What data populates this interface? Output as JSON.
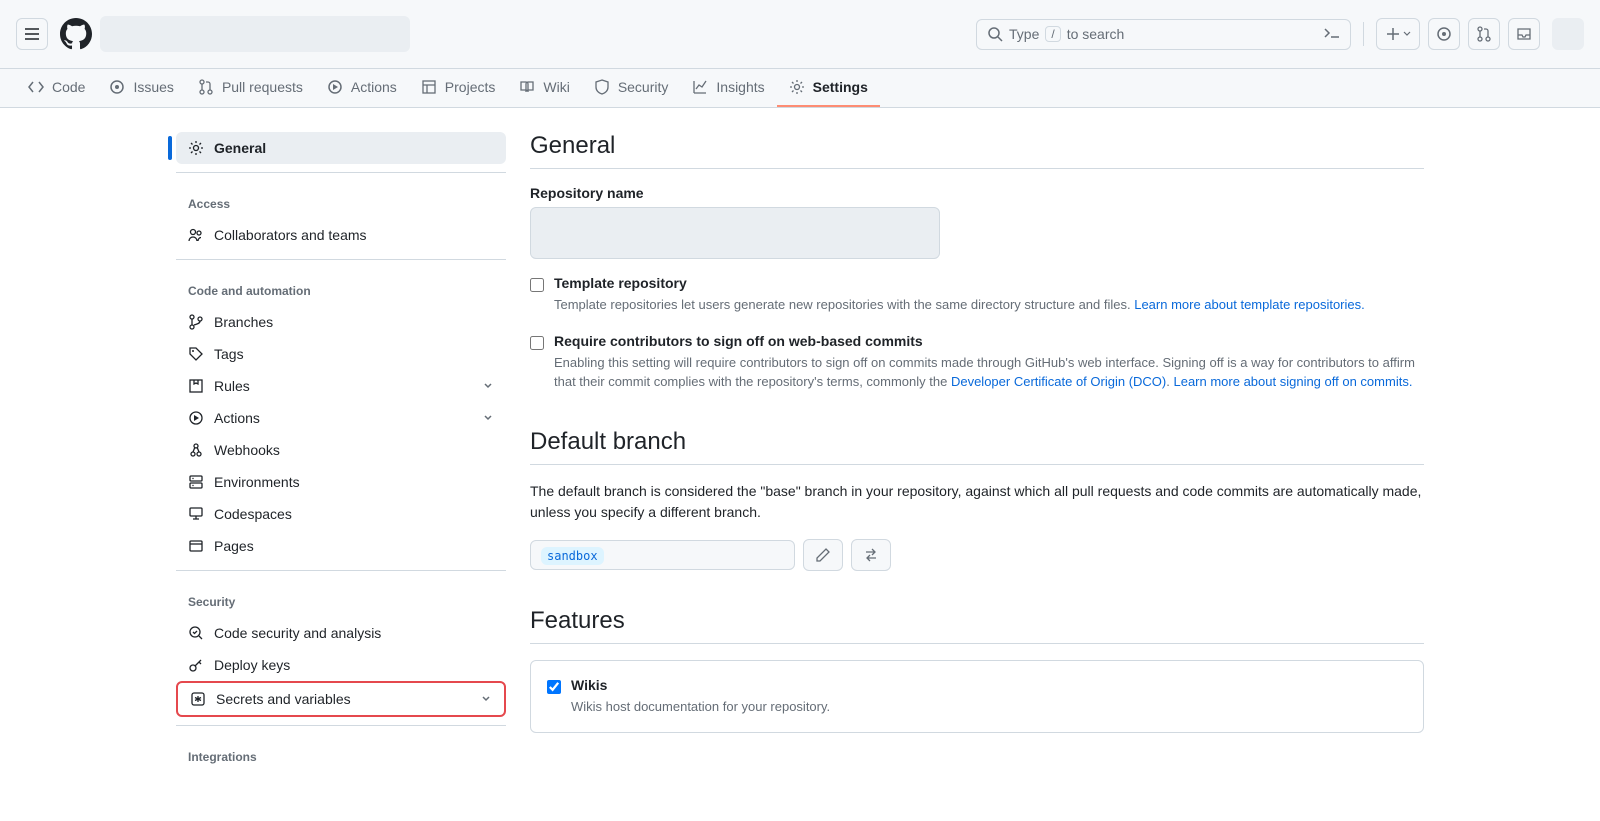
{
  "search": {
    "before": "Type",
    "kbd": "/",
    "after": "to search"
  },
  "repo_nav": {
    "code": "Code",
    "issues": "Issues",
    "pulls": "Pull requests",
    "actions": "Actions",
    "projects": "Projects",
    "wiki": "Wiki",
    "security": "Security",
    "insights": "Insights",
    "settings": "Settings"
  },
  "sidebar": {
    "general": "General",
    "access_hd": "Access",
    "collab": "Collaborators and teams",
    "code_hd": "Code and automation",
    "branches": "Branches",
    "tags": "Tags",
    "rules": "Rules",
    "actions": "Actions",
    "webhooks": "Webhooks",
    "environments": "Environments",
    "codespaces": "Codespaces",
    "pages": "Pages",
    "security_hd": "Security",
    "codesec": "Code security and analysis",
    "deploy": "Deploy keys",
    "secrets": "Secrets and variables",
    "integrations_hd": "Integrations"
  },
  "general": {
    "heading": "General",
    "repo_name_label": "Repository name",
    "template": {
      "title": "Template repository",
      "desc": "Template repositories let users generate new repositories with the same directory structure and files. ",
      "link": "Learn more about template repositories."
    },
    "signoff": {
      "title": "Require contributors to sign off on web-based commits",
      "desc1": "Enabling this setting will require contributors to sign off on commits made through GitHub's web interface. Signing off is a way for contributors to affirm that their commit complies with the repository's terms, commonly the ",
      "dco": "Developer Certificate of Origin (DCO)",
      "period": ". ",
      "link": "Learn more about signing off on commits."
    }
  },
  "default_branch": {
    "heading": "Default branch",
    "desc": "The default branch is considered the \"base\" branch in your repository, against which all pull requests and code commits are automatically made, unless you specify a different branch.",
    "branch": "sandbox"
  },
  "features": {
    "heading": "Features",
    "wikis": {
      "title": "Wikis",
      "desc": "Wikis host documentation for your repository."
    }
  }
}
